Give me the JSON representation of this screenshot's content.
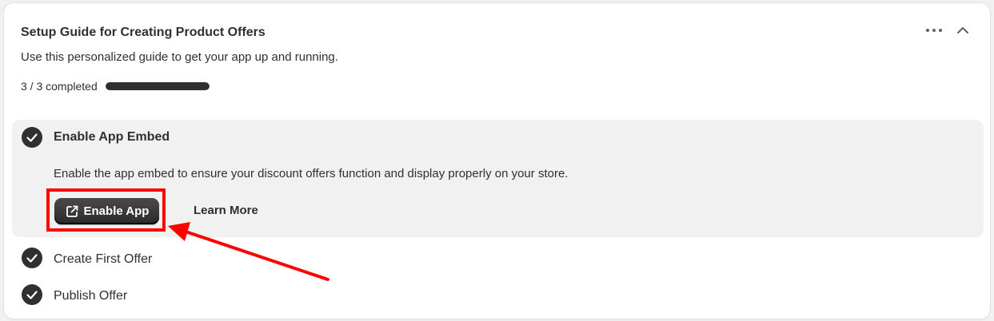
{
  "card": {
    "title": "Setup Guide for Creating Product Offers",
    "subtitle": "Use this personalized guide to get your app up and running.",
    "progress_text": "3 / 3 completed",
    "progress_fraction": 1.0,
    "menu_icon": "more-horizontal-icon",
    "collapse_icon": "chevron-up-icon"
  },
  "steps": [
    {
      "title": "Enable App Embed",
      "description": "Enable the app embed to ensure your discount offers function and display properly on your store.",
      "primary_button": "Enable App",
      "primary_icon": "external-link-icon",
      "secondary_button": "Learn More",
      "completed": true,
      "expanded": true
    },
    {
      "title": "Create First Offer",
      "completed": true,
      "expanded": false
    },
    {
      "title": "Publish Offer",
      "completed": true,
      "expanded": false
    }
  ],
  "annotation": {
    "color": "#ff0000"
  },
  "colors": {
    "primary": "#303030",
    "card_bg": "#ffffff",
    "page_bg": "#f1f1f1"
  }
}
